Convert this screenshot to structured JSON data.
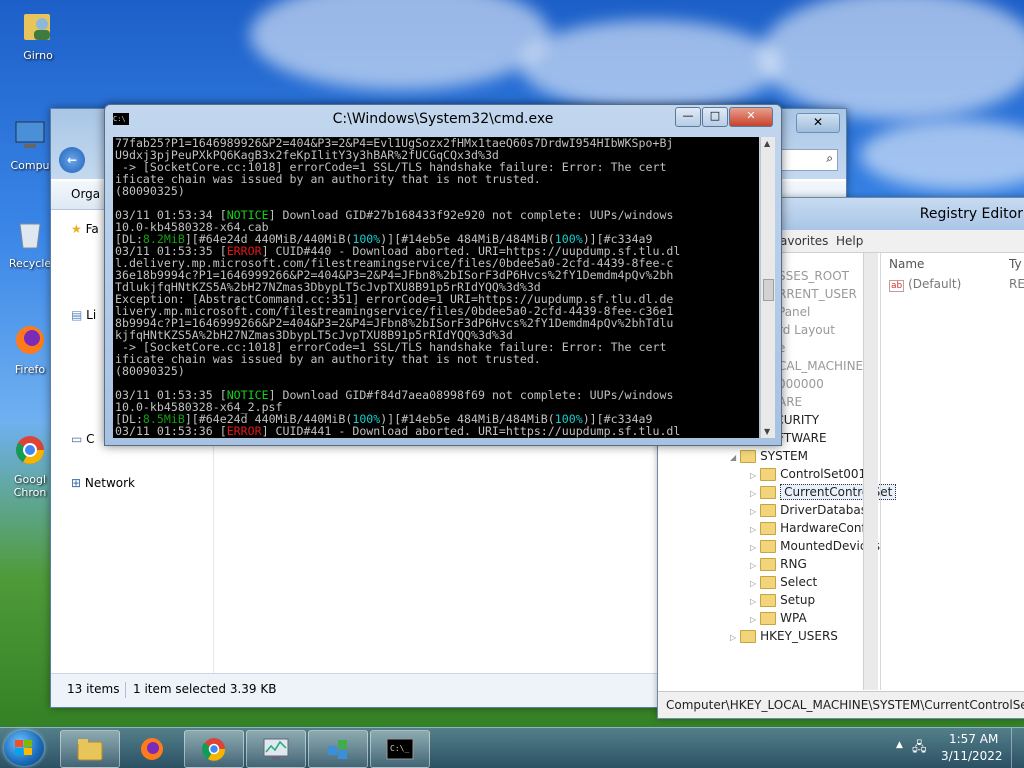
{
  "desktop": {
    "icons": [
      {
        "label": "Girno"
      },
      {
        "label": "Compu"
      },
      {
        "label": "Recycle"
      },
      {
        "label": "Firefo"
      },
      {
        "label": "Googl Chron"
      }
    ]
  },
  "explorer": {
    "organize_label": "Orga",
    "nav_favorites": "Fa",
    "nav_libraries": "Li",
    "nav_computer": "C",
    "nav_network": "Network",
    "status_items": "13 items",
    "status_selected": "1 item selected  3.39 KB"
  },
  "cmd": {
    "title": "C:\\Windows\\System32\\cmd.exe",
    "icon_text": "C:\\",
    "minimize": "—",
    "maximize": "□",
    "close": "✕",
    "lines": [
      {
        "t": "77fab25?P1=1646989926&P2=404&P3=2&P4=Evl1UgSozx2fHMx1taeQ60s7DrdwI954HIbWKSpo+Bj"
      },
      {
        "t": "U9dxj3pjPeuPXkPQ6KagB3x2feKpIlitY3y3hBAR%2fUCGqCQx3d%3d"
      },
      {
        "t": " -> [SocketCore.cc:1018] errorCode=1 SSL/TLS handshake failure: Error: The cert"
      },
      {
        "t": "ificate chain was issued by an authority that is not trusted."
      },
      {
        "t": "(80090325)"
      },
      {
        "t": ""
      },
      {
        "t": "03/11 01:53:34 [",
        "tag": "NOTICE",
        "rest": "] Download GID#27b168433f92e920 not complete: UUPs/windows"
      },
      {
        "t": "10.0-kb4580328-x64.cab"
      },
      {
        "t": "[DL:",
        "speed": "8.2MiB",
        "p1": "][#64e24d 440MiB/440MiB(",
        "pct1": "100%",
        "p2": ")][#14eb5e 484MiB/484MiB(",
        "pct2": "100%",
        "p3": ")][#c334a9"
      },
      {
        "t": "03/11 01:53:35 [",
        "err": "ERROR",
        "rest": "] CUID#440 - Download aborted. URI=https://uupdump.sf.tlu.dl"
      },
      {
        "t": "l.delivery.mp.microsoft.com/filestreamingservice/files/0bdee5a0-2cfd-4439-8fee-c"
      },
      {
        "t": "36e18b9994c?P1=1646999266&P2=404&P3=2&P4=JFbn8%2bISorF3dP6Hvcs%2fY1Demdm4pQv%2bh"
      },
      {
        "t": "TdlukjfqHNtKZS5A%2bH27NZmas3DbypLT5cJvpTXU8B91p5rRIdYQQ%3d%3d"
      },
      {
        "t": "Exception: [AbstractCommand.cc:351] errorCode=1 URI=https://uupdump.sf.tlu.dl.de"
      },
      {
        "t": "livery.mp.microsoft.com/filestreamingservice/files/0bdee5a0-2cfd-4439-8fee-c36e1"
      },
      {
        "t": "8b9994c?P1=1646999266&P2=404&P3=2&P4=JFbn8%2bISorF3dP6Hvcs%2fY1Demdm4pQv%2bhTdlu"
      },
      {
        "t": "kjfqHNtKZS5A%2bH27NZmas3DbypLT5cJvpTXU8B91p5rRIdYQQ%3d%3d"
      },
      {
        "t": " -> [SocketCore.cc:1018] errorCode=1 SSL/TLS handshake failure: Error: The cert"
      },
      {
        "t": "ificate chain was issued by an authority that is not trusted."
      },
      {
        "t": "(80090325)"
      },
      {
        "t": ""
      },
      {
        "t": "03/11 01:53:35 [",
        "tag": "NOTICE",
        "rest": "] Download GID#f84d7aea08998f69 not complete: UUPs/windows"
      },
      {
        "t": "10.0-kb4580328-x64_2.psf"
      },
      {
        "t": "[DL:",
        "speed": "8.5MiB",
        "p1": "][#64e24d 440MiB/440MiB(",
        "pct1": "100%",
        "p2": ")][#14eb5e 484MiB/484MiB(",
        "pct2": "100%",
        "p3": ")][#c334a9"
      },
      {
        "t": "03/11 01:53:36 [",
        "err": "ERROR",
        "rest": "] CUID#441 - Download aborted. URI=https://uupdump.sf.tlu.dl"
      }
    ]
  },
  "regedit": {
    "title": "Registry Editor",
    "menu": [
      "avorites",
      "Help"
    ],
    "tree": [
      {
        "label": "SSES_ROOT",
        "indent": 0
      },
      {
        "label": "RRENT_USER",
        "indent": 0
      },
      {
        "label": " Panel",
        "indent": 0
      },
      {
        "label": "rd Layout",
        "indent": 0
      },
      {
        "label": "e",
        "indent": 0
      },
      {
        "label": "CAL_MACHINE",
        "indent": 0
      },
      {
        "label": "000000",
        "indent": 0
      },
      {
        "label": "ARE",
        "indent": 0
      },
      {
        "label": "SECURITY",
        "indent": 1
      },
      {
        "label": "SOFTWARE",
        "indent": 1
      },
      {
        "label": "SYSTEM",
        "indent": 1
      },
      {
        "label": "ControlSet001",
        "indent": 2
      },
      {
        "label": "CurrentControlSet",
        "indent": 2,
        "selected": true
      },
      {
        "label": "DriverDatabase",
        "indent": 2
      },
      {
        "label": "HardwareConfig",
        "indent": 2
      },
      {
        "label": "MountedDevices",
        "indent": 2
      },
      {
        "label": "RNG",
        "indent": 2
      },
      {
        "label": "Select",
        "indent": 2
      },
      {
        "label": "Setup",
        "indent": 2
      },
      {
        "label": "WPA",
        "indent": 2
      },
      {
        "label": "HKEY_USERS",
        "indent": 1
      }
    ],
    "values_header_name": "Name",
    "values_header_type": "Ty",
    "value_default": "(Default)",
    "value_default_type": "RE",
    "path": "Computer\\HKEY_LOCAL_MACHINE\\SYSTEM\\CurrentControlSet"
  },
  "taskbar": {
    "time": "1:57 AM",
    "date": "3/11/2022"
  }
}
